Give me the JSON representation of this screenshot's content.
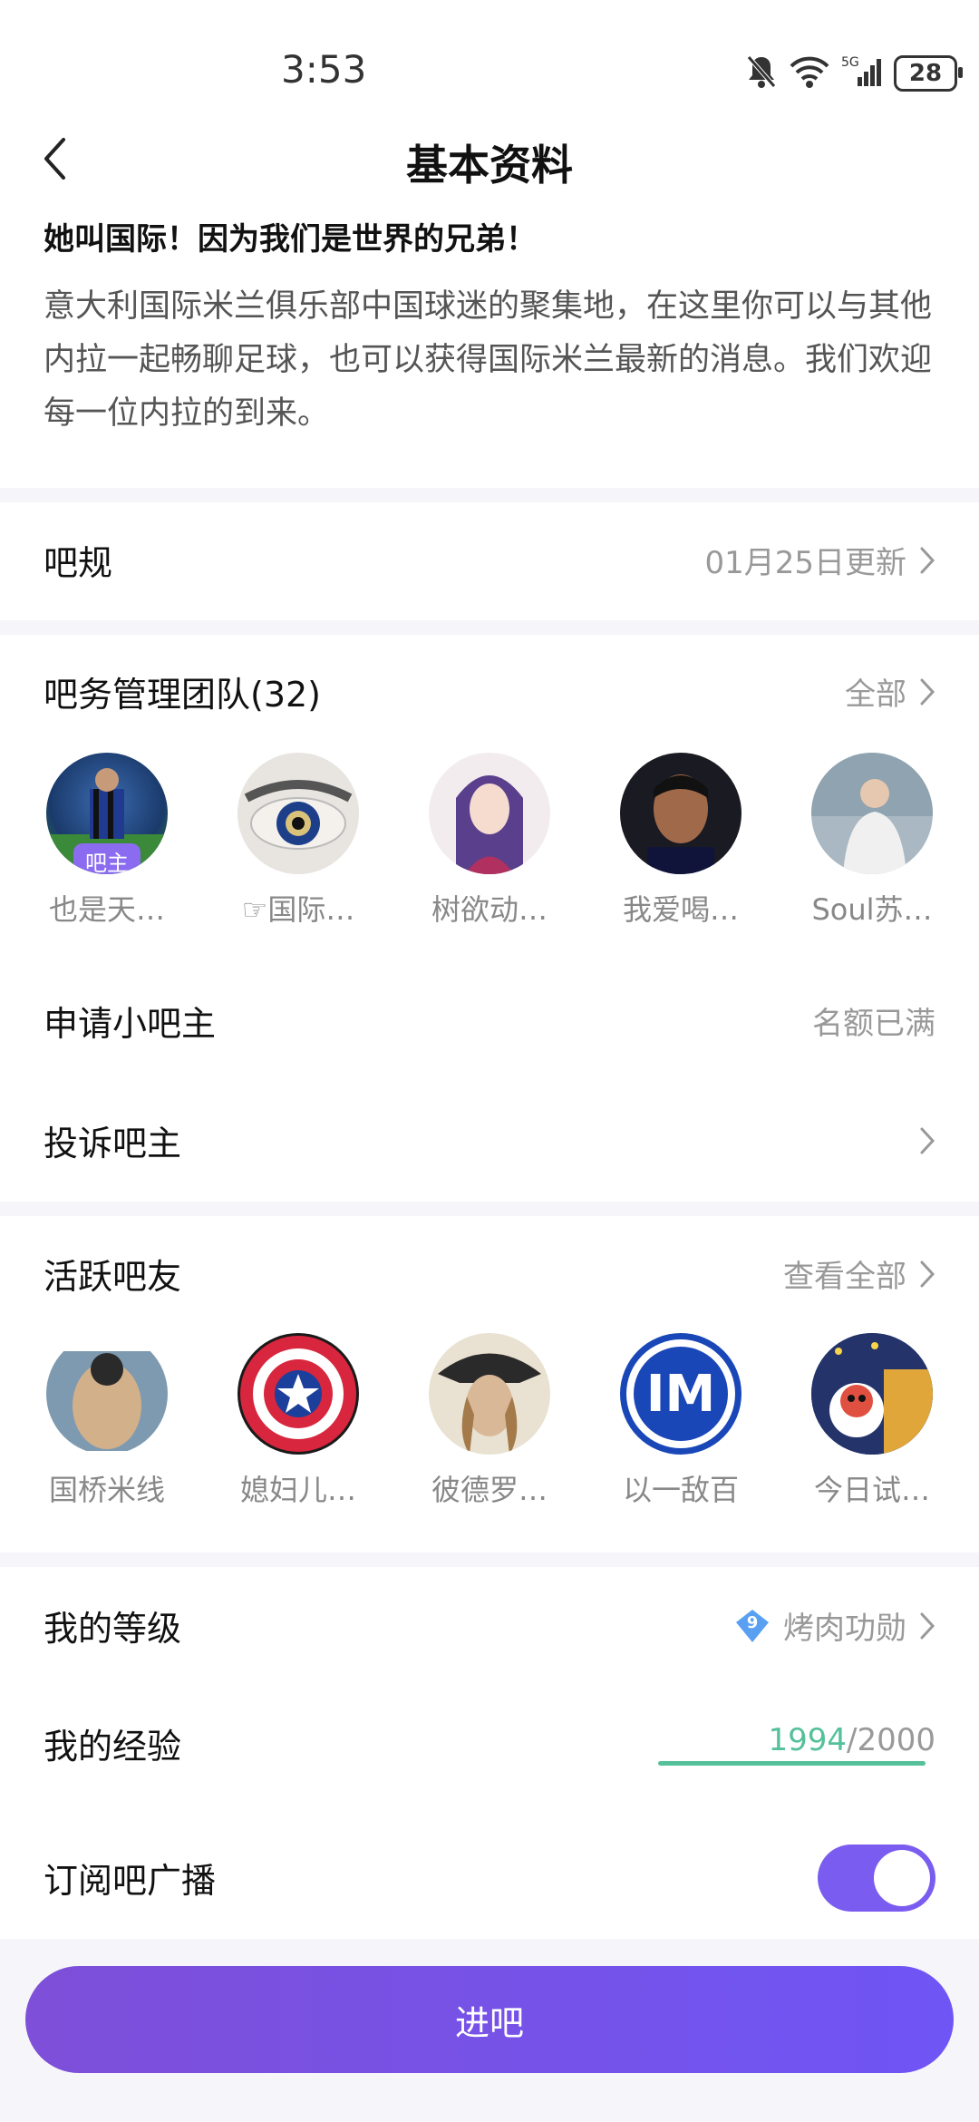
{
  "status": {
    "time": "3:53",
    "battery": "28"
  },
  "header": {
    "title": "基本资料"
  },
  "intro": {
    "title": "她叫国际！因为我们是世界的兄弟！",
    "description": "意大利国际米兰俱乐部中国球迷的聚集地，在这里你可以与其他内拉一起畅聊足球，也可以获得国际米兰最新的消息。我们欢迎每一位内拉的到来。"
  },
  "rules": {
    "label": "吧规",
    "value": "01月25日更新"
  },
  "team": {
    "label": "吧务管理团队(32)",
    "all": "全部",
    "badge": "吧主",
    "members": [
      {
        "name": "也是天…"
      },
      {
        "name": "☞国际…"
      },
      {
        "name": "树欲动…"
      },
      {
        "name": "我爱喝…"
      },
      {
        "name": "Soul苏…"
      }
    ]
  },
  "apply": {
    "label": "申请小吧主",
    "value": "名额已满"
  },
  "complain": {
    "label": "投诉吧主"
  },
  "active": {
    "label": "活跃吧友",
    "all": "查看全部",
    "members": [
      {
        "name": "国桥米线"
      },
      {
        "name": "媳妇儿…"
      },
      {
        "name": "彼德罗…"
      },
      {
        "name": "以一敌百"
      },
      {
        "name": "今日试…"
      }
    ]
  },
  "level": {
    "label": "我的等级",
    "level_num": "9",
    "value": "烤肉功勋"
  },
  "experience": {
    "label": "我的经验",
    "current": "1994",
    "total": "/2000",
    "progress": 0.997
  },
  "subscribe": {
    "label": "订阅吧广播",
    "on": true
  },
  "enter_button": "进吧",
  "colors": {
    "accent": "#7a5cf0",
    "progress": "#55c09a"
  }
}
